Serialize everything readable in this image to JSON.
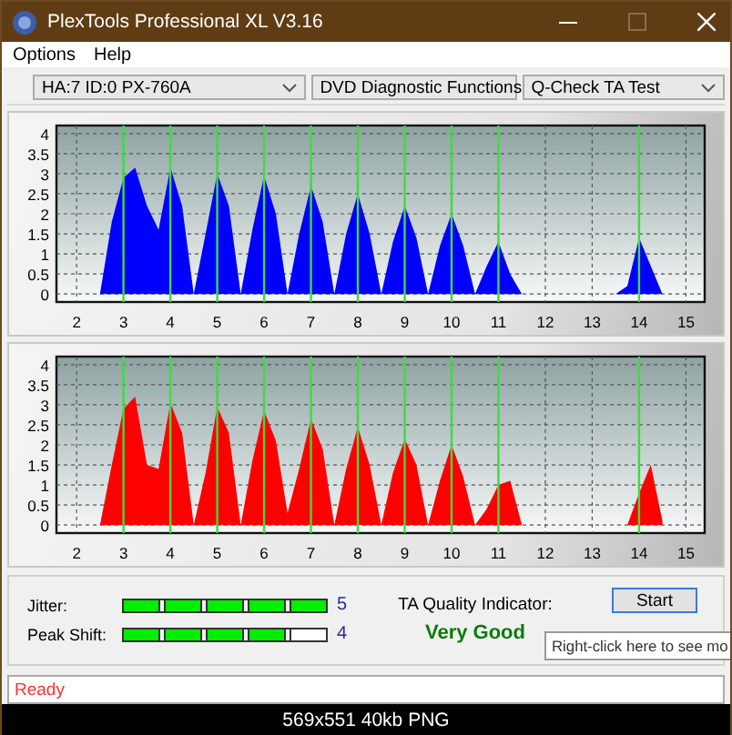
{
  "window": {
    "title": "PlexTools Professional XL V3.16"
  },
  "menu": [
    "Options",
    "Help"
  ],
  "toolbar": [
    {
      "value": "HA:7 ID:0  PX-760A"
    },
    {
      "value": "DVD Diagnostic Functions"
    },
    {
      "value": "Q-Check TA Test"
    }
  ],
  "charts": [
    {
      "chart_data": {
        "type": "area",
        "xlim": [
          1.57,
          15.4
        ],
        "ylim": [
          -0.2,
          4.2
        ],
        "xticks": [
          2,
          3,
          4,
          5,
          6,
          7,
          8,
          9,
          10,
          11,
          12,
          13,
          14,
          15
        ],
        "yticks": [
          0,
          0.5,
          1,
          1.5,
          2,
          2.5,
          3,
          3.5,
          4
        ],
        "grid": true,
        "x": [
          2.5,
          2.75,
          3,
          3.25,
          3.5,
          3.75,
          4,
          4.25,
          4.5,
          4.75,
          5,
          5.25,
          5.5,
          5.75,
          6,
          6.25,
          6.5,
          6.75,
          7,
          7.25,
          7.5,
          7.75,
          8,
          8.25,
          8.5,
          8.75,
          9,
          9.25,
          9.5,
          9.75,
          10,
          10.25,
          10.5,
          10.75,
          11,
          11.25,
          11.5,
          11.75,
          12,
          12.25,
          12.5,
          12.75,
          13,
          13.25,
          13.5,
          13.75,
          14,
          14.25,
          14.5
        ],
        "series": [
          {
            "color": "#0000ff",
            "values": [
              0,
              1.8,
              2.9,
              3.15,
              2.2,
              1.6,
              3.15,
              2.2,
              0,
              1.5,
              3.0,
              2.2,
              0,
              1.6,
              2.95,
              2.0,
              0,
              1.5,
              2.7,
              1.8,
              0,
              1.5,
              2.5,
              1.5,
              0,
              1.3,
              2.2,
              1.4,
              0,
              1.2,
              2.0,
              1.2,
              0,
              0.7,
              1.3,
              0.5,
              0,
              0,
              0,
              0,
              0,
              0,
              0,
              0,
              0,
              0.2,
              1.4,
              0.7,
              0
            ]
          }
        ]
      }
    },
    {
      "chart_data": {
        "type": "area",
        "xlim": [
          1.57,
          15.4
        ],
        "ylim": [
          -0.2,
          4.2
        ],
        "xticks": [
          2,
          3,
          4,
          5,
          6,
          7,
          8,
          9,
          10,
          11,
          12,
          13,
          14,
          15
        ],
        "yticks": [
          0,
          0.5,
          1,
          1.5,
          2,
          2.5,
          3,
          3.5,
          4
        ],
        "grid": true,
        "x": [
          2.5,
          2.75,
          3,
          3.25,
          3.5,
          3.75,
          4,
          4.25,
          4.5,
          4.75,
          5,
          5.25,
          5.5,
          5.75,
          6,
          6.25,
          6.5,
          6.75,
          7,
          7.25,
          7.5,
          7.75,
          8,
          8.25,
          8.5,
          8.75,
          9,
          9.25,
          9.5,
          9.75,
          10,
          10.25,
          10.5,
          10.75,
          11,
          11.25,
          11.5,
          11.75,
          12,
          12.25,
          12.5,
          12.75,
          13,
          13.25,
          13.5,
          13.75,
          14,
          14.25,
          14.5
        ],
        "series": [
          {
            "color": "#ff0000",
            "values": [
              0,
              1.5,
              2.9,
              3.2,
              1.5,
              1.4,
              3.05,
              2.3,
              0,
              1.3,
              2.95,
              2.3,
              0,
              1.6,
              2.85,
              2.1,
              0.3,
              1.4,
              2.65,
              1.9,
              0,
              1.4,
              2.45,
              1.5,
              0,
              1.3,
              2.15,
              1.5,
              0,
              1.1,
              2.0,
              1.2,
              0,
              0.4,
              1.0,
              1.1,
              0,
              0,
              0,
              0,
              0,
              0,
              0,
              0,
              0,
              0,
              0.8,
              1.5,
              0.1
            ]
          }
        ]
      }
    }
  ],
  "meters": [
    {
      "label": "Jitter:",
      "level": 1,
      "reading": "5"
    },
    {
      "label": "Peak Shift:",
      "level": 0.8,
      "reading": "4"
    }
  ],
  "quality": {
    "label": "TA Quality Indicator:",
    "value": "Very Good"
  },
  "start_button": "Start",
  "tooltip": "Right-click here to see mo",
  "status_bar": "Ready",
  "image_caption": "569x551 40kb PNG"
}
